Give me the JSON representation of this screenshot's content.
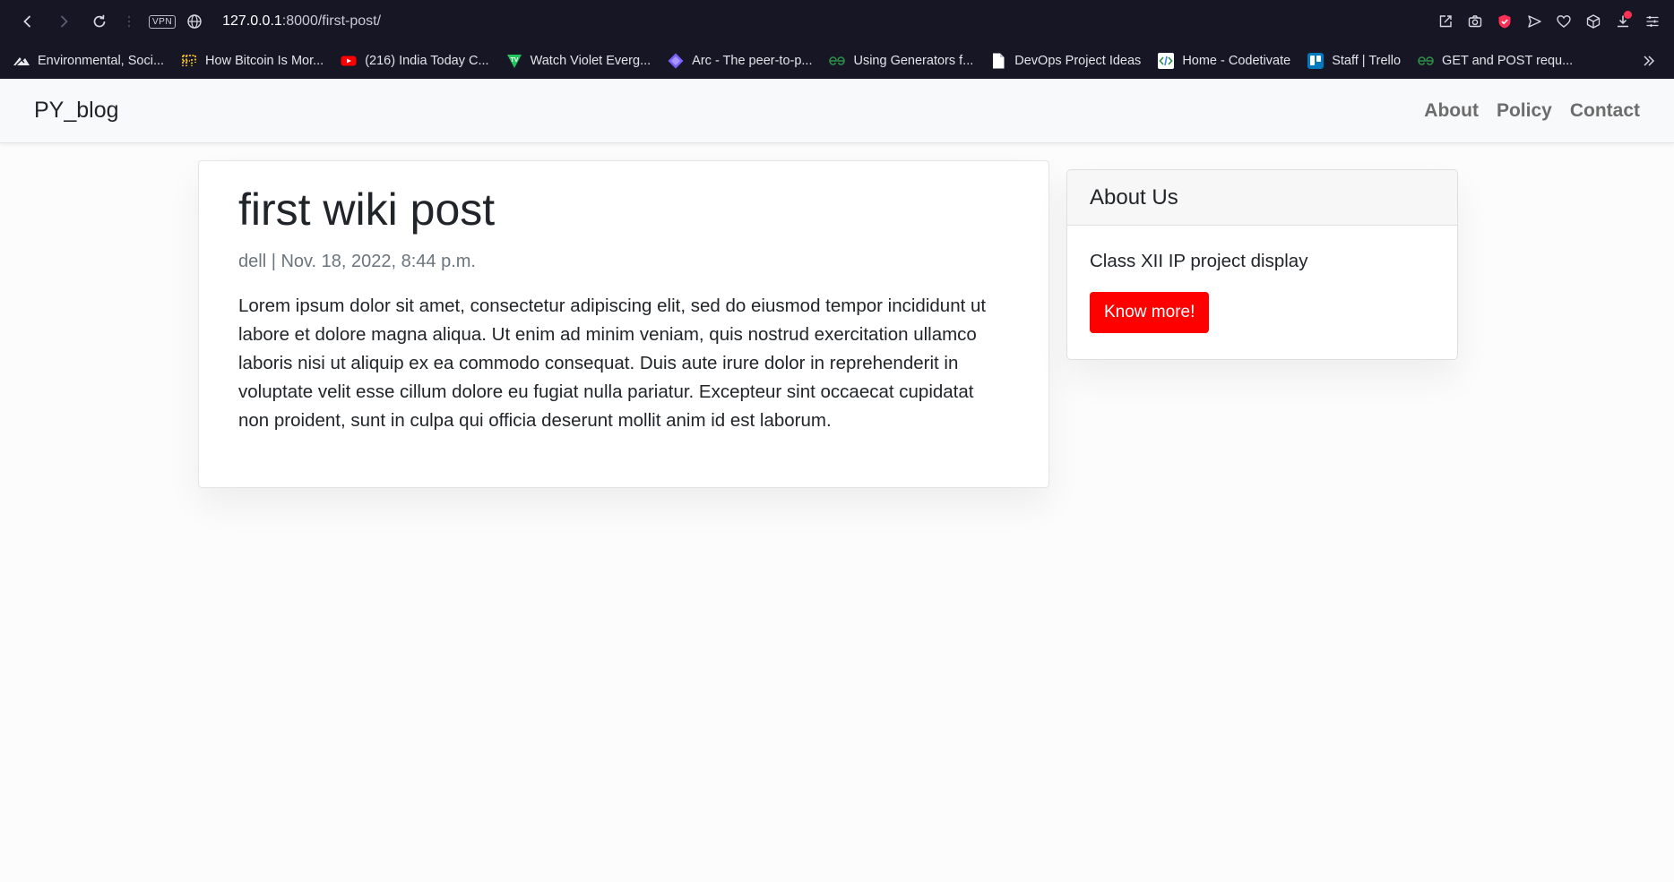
{
  "browser": {
    "vpn_label": "VPN",
    "url_host": "127.0.0.1",
    "url_rest": ":8000/first-post/",
    "bookmarks": [
      {
        "label": "Environmental, Soci...",
        "icon": "mountain-logo-icon"
      },
      {
        "label": "How Bitcoin Is Mor...",
        "icon": "bitcoin-grid-icon"
      },
      {
        "label": "(216) India Today C...",
        "icon": "youtube-icon"
      },
      {
        "label": "Watch Violet Everg...",
        "icon": "tv-shield-icon"
      },
      {
        "label": "Arc - The peer-to-p...",
        "icon": "arc-diamond-icon"
      },
      {
        "label": "Using Generators f...",
        "icon": "geeksforgeeks-icon"
      },
      {
        "label": "DevOps Project Ideas",
        "icon": "document-icon"
      },
      {
        "label": "Home - Codetivate",
        "icon": "code-icon"
      },
      {
        "label": "Staff | Trello",
        "icon": "trello-icon"
      },
      {
        "label": "GET and POST requ...",
        "icon": "geeksforgeeks-icon"
      }
    ]
  },
  "site": {
    "brand": "PY_blog",
    "nav": [
      {
        "label": "About"
      },
      {
        "label": "Policy"
      },
      {
        "label": "Contact"
      }
    ]
  },
  "post": {
    "title": "first wiki post",
    "meta": "dell | Nov. 18, 2022, 8:44 p.m.",
    "body": "Lorem ipsum dolor sit amet, consectetur adipiscing elit, sed do eiusmod tempor incididunt ut labore et dolore magna aliqua. Ut enim ad minim veniam, quis nostrud exercitation ullamco laboris nisi ut aliquip ex ea commodo consequat. Duis aute irure dolor in reprehenderit in voluptate velit esse cillum dolore eu fugiat nulla pariatur. Excepteur sint occaecat cupidatat non proident, sunt in culpa qui officia deserunt mollit anim id est laborum."
  },
  "sidebar": {
    "header": "About Us",
    "text": "Class XII IP project display",
    "button_label": "Know more!"
  },
  "colors": {
    "chrome_bg": "#161625",
    "accent_button": "#ff0000",
    "navbar_bg": "#f8f9fa"
  }
}
